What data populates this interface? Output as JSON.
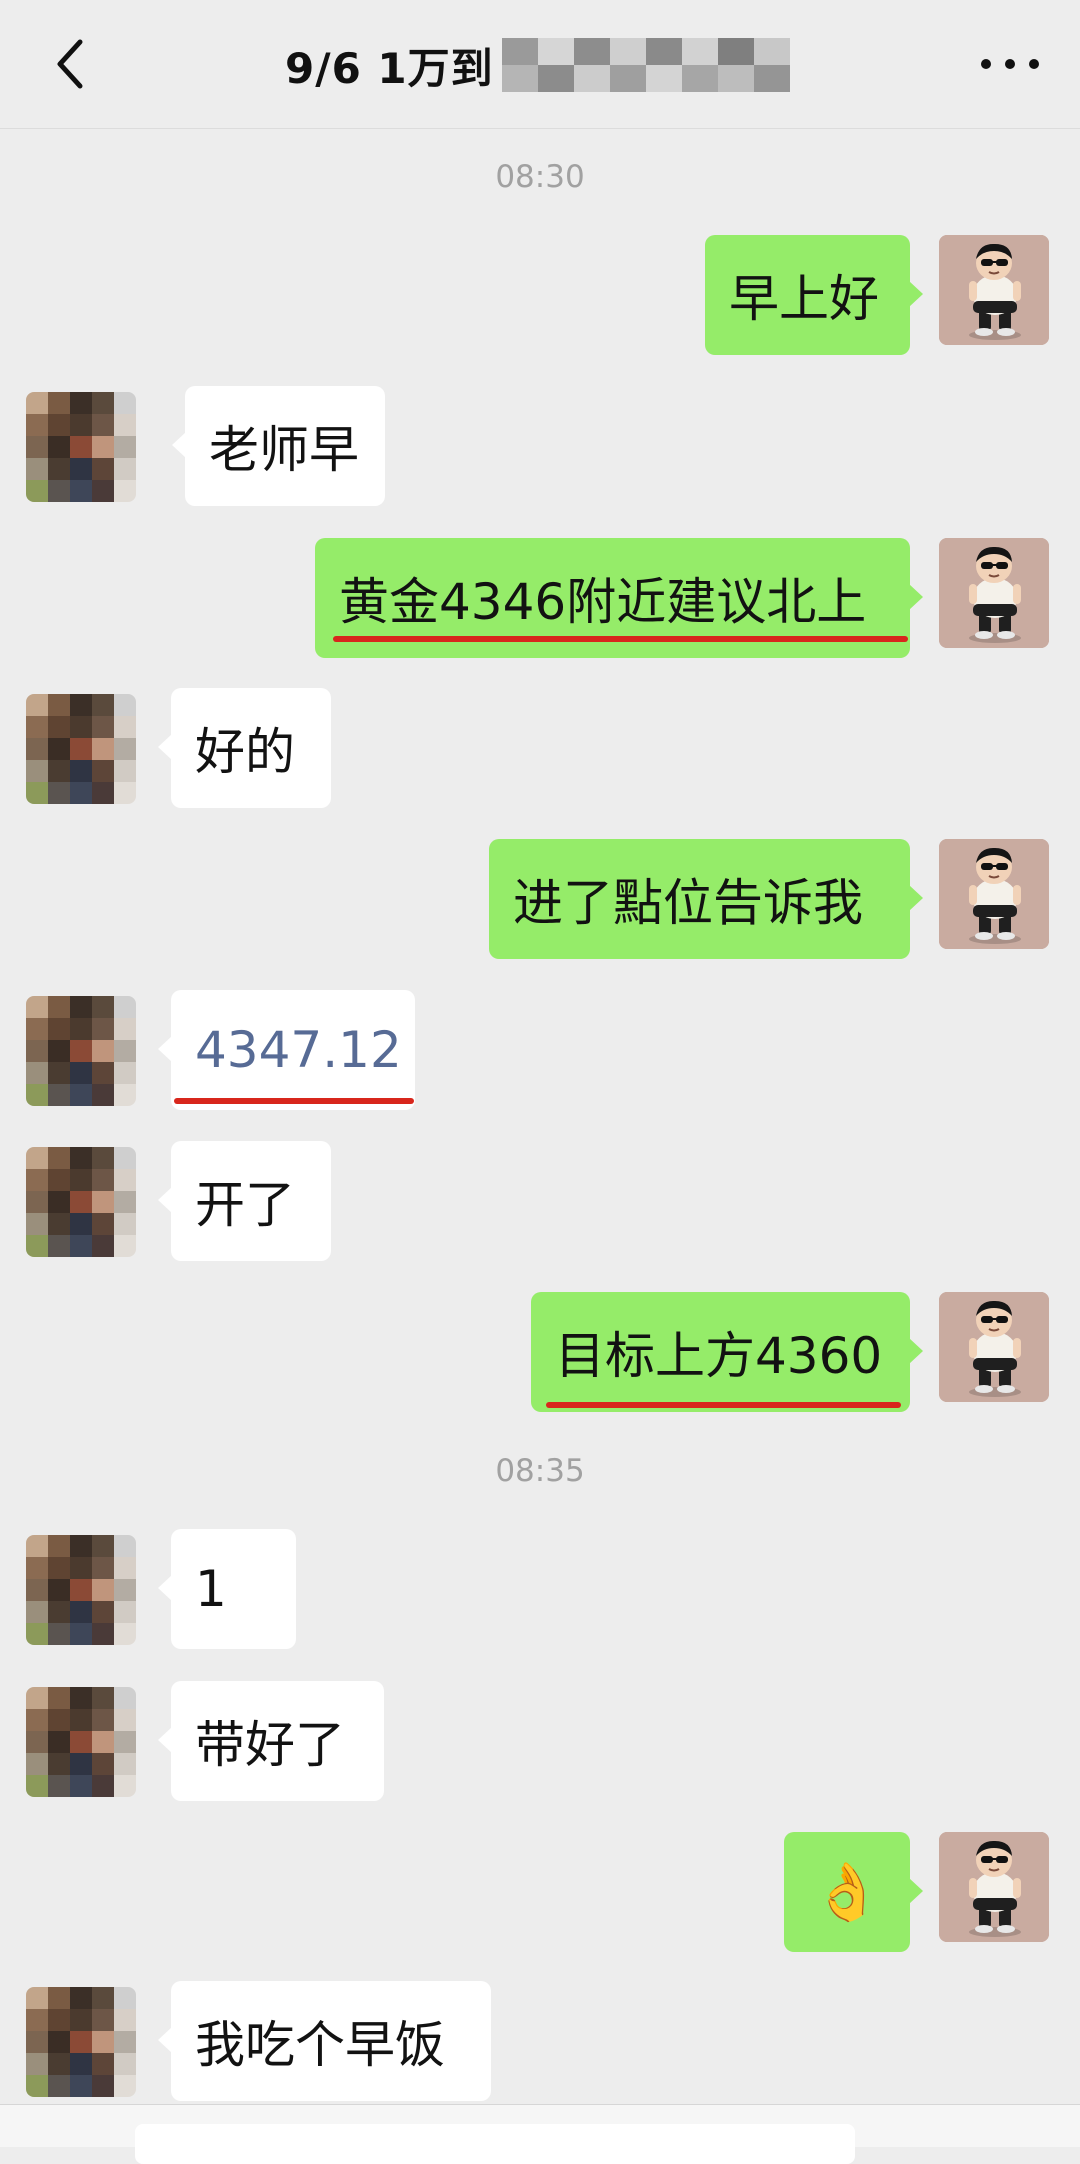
{
  "header": {
    "title": "9/6  1万到",
    "mosaic_colors": [
      "#9a9a9a",
      "#d6d6d6",
      "#8d8d8d",
      "#cfcfcf",
      "#8a8a8a",
      "#d2d2d2",
      "#7f7f7f",
      "#c8c8c8",
      "#b5b5b5",
      "#8c8c8c",
      "#cccccc",
      "#9f9f9f",
      "#d4d4d4",
      "#a6a6a6",
      "#bdbdbd",
      "#959595"
    ]
  },
  "messages": [
    {
      "type": "time",
      "text": "08:30"
    },
    {
      "side": "right",
      "text": "早上好"
    },
    {
      "side": "left",
      "text": "老师早"
    },
    {
      "side": "right",
      "text": "黄金4346附近建议北上"
    },
    {
      "side": "left",
      "text": "好的"
    },
    {
      "side": "right",
      "text": "进了點位告诉我"
    },
    {
      "side": "left",
      "text": "4347.12"
    },
    {
      "side": "left",
      "text": "开了"
    },
    {
      "side": "right",
      "text": "目标上方4360"
    },
    {
      "type": "time",
      "text": "08:35"
    },
    {
      "side": "left",
      "text": "1"
    },
    {
      "side": "left",
      "text": "带好了"
    },
    {
      "side": "right",
      "text": "👌"
    },
    {
      "side": "left",
      "text": "我吃个早饭"
    }
  ],
  "colors": {
    "background": "#ededed",
    "self_bubble": "#95ec69",
    "other_bubble": "#ffffff",
    "highlight_line": "#d8261c",
    "link_text": "#576b95"
  },
  "icons": {
    "back": "chevron-left-icon",
    "more": "more-dots-icon",
    "self_avatar": "cartoon-avatar-icon",
    "other_avatar": "pixelated-avatar-icon"
  }
}
